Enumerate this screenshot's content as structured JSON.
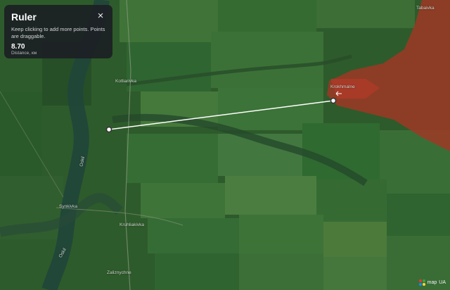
{
  "ruler": {
    "title": "Ruler",
    "hint": "Keep clicking to add more points. Points are draggable.",
    "distance_value": "8.70",
    "distance_unit": "Distance, км",
    "close_symbol": "×"
  },
  "places": {
    "tabaivka": "Tabaivka",
    "kotliarivka": "Kotliarivka",
    "synkivka": "Synkivka",
    "krokhmalne": "Krokhmalne",
    "kruhliakivka": "Kruhliakivka",
    "zaliznychne": "Zaliznychne",
    "oskil": "Oskil",
    "oskil_south": "Oskil"
  },
  "attribution": {
    "brand": "map",
    "suffix": "UA"
  },
  "colors": {
    "occupied_zone": "#a83424",
    "ruler_line": "#ffffff",
    "river": "#20453a"
  }
}
